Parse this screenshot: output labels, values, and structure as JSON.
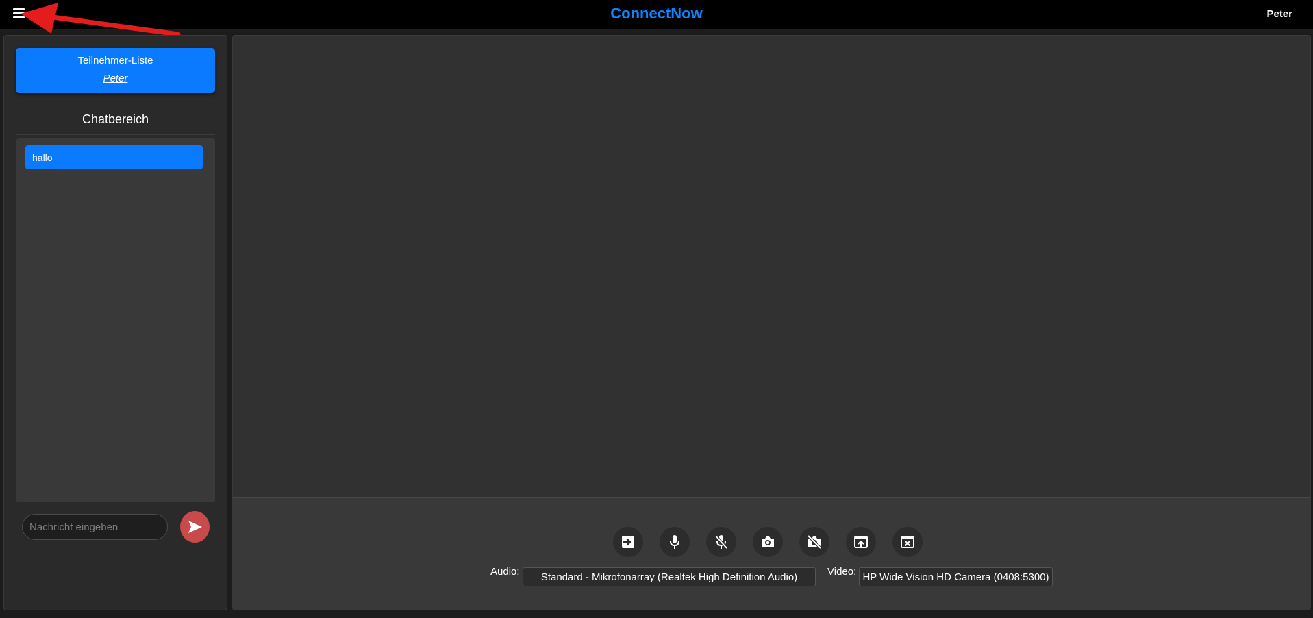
{
  "header": {
    "brand": "ConnectNow",
    "username": "Peter",
    "menu_icon": "hamburger-menu-icon",
    "accent_color": "#0a84ff"
  },
  "annotation": {
    "arrow_color": "#e41c1c"
  },
  "sidebar": {
    "participants_title": "Teilnehmer-Liste",
    "participants": [
      "Peter"
    ],
    "chat_heading": "Chatbereich",
    "messages": [
      "hallo"
    ],
    "input_placeholder": "Nachricht eingeben",
    "send_icon": "send-icon",
    "send_color": "#c84a4a"
  },
  "controls": {
    "buttons": [
      {
        "name": "join-icon"
      },
      {
        "name": "microphone-icon"
      },
      {
        "name": "microphone-off-icon"
      },
      {
        "name": "camera-icon"
      },
      {
        "name": "camera-off-icon"
      },
      {
        "name": "screen-share-icon"
      },
      {
        "name": "close-screen-share-icon"
      }
    ],
    "audio_label": "Audio:",
    "audio_device": "Standard - Mikrofonarray (Realtek High Definition Audio)",
    "video_label": "Video:",
    "video_device": "HP Wide Vision HD Camera (0408:5300)"
  }
}
